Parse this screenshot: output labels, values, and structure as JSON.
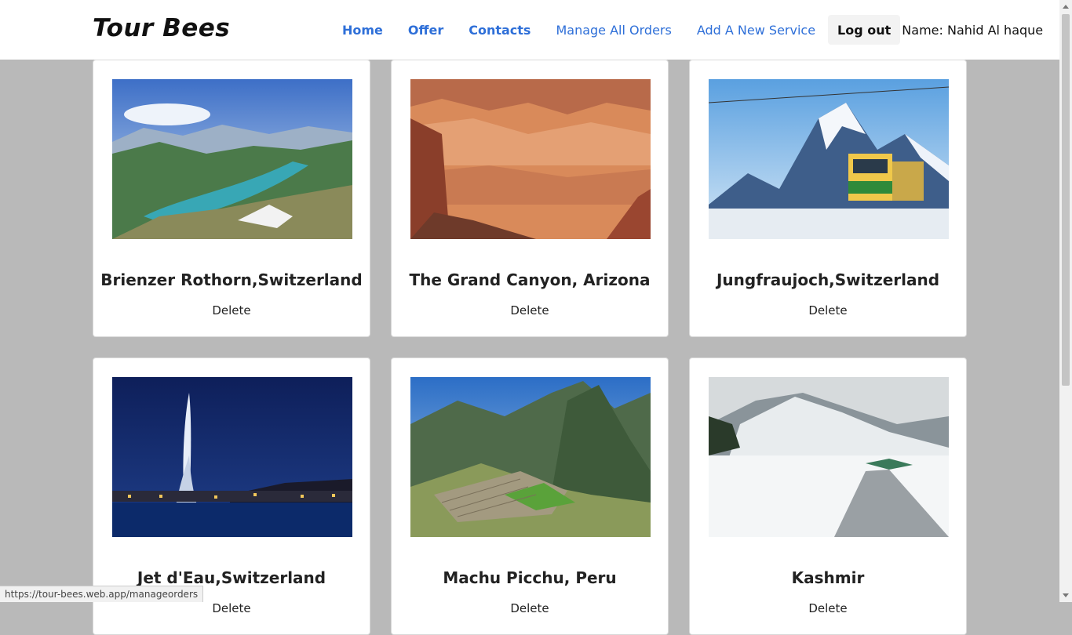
{
  "brand": "Tour Bees",
  "nav": {
    "links": [
      "Home",
      "Offer",
      "Contacts",
      "Manage All Orders",
      "Add A New Service"
    ],
    "logout": "Log out",
    "username": "Name: Nahid Al haque"
  },
  "cards": [
    {
      "title": "Brienzer Rothorn,Switzerland",
      "action": "Delete",
      "image": "lake-mountain-photo"
    },
    {
      "title": "The Grand Canyon, Arizona",
      "action": "Delete",
      "image": "canyon-photo"
    },
    {
      "title": "Jungfraujoch,Switzerland",
      "action": "Delete",
      "image": "mountain-train-photo"
    },
    {
      "title": "Jet d'Eau,Switzerland",
      "action": "Delete",
      "image": "fountain-night-photo"
    },
    {
      "title": "Machu Picchu, Peru",
      "action": "Delete",
      "image": "machu-picchu-photo"
    },
    {
      "title": "Kashmir",
      "action": "Delete",
      "image": "snow-valley-photo"
    }
  ],
  "status_url": "https://tour-bees.web.app/manageorders",
  "colors": {
    "link": "#2e6fd8",
    "background": "#b9b9b9",
    "card": "#ffffff"
  }
}
